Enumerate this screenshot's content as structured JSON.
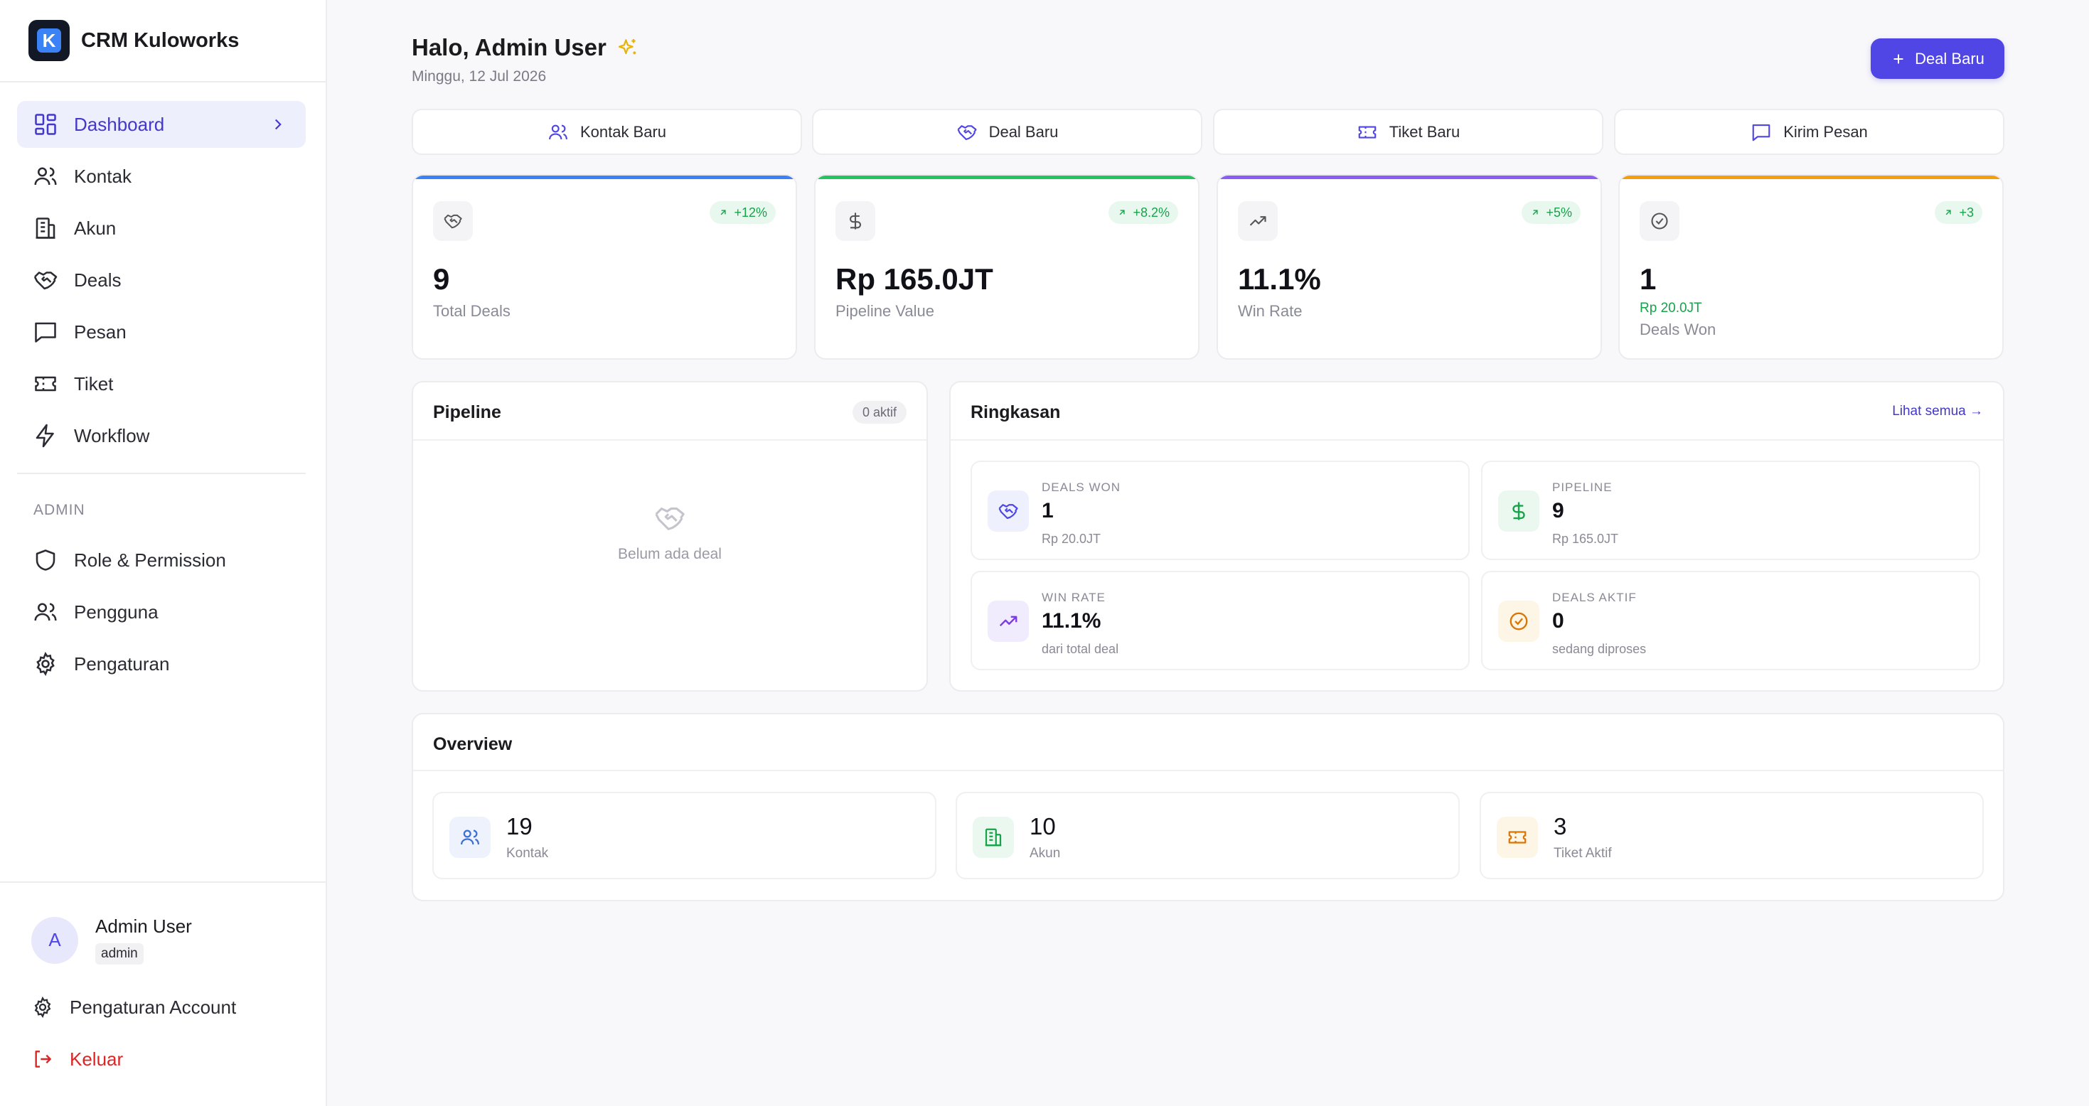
{
  "app": {
    "name": "CRM Kuloworks",
    "logo_letter": "K"
  },
  "sidebar": {
    "nav": [
      {
        "label": "Dashboard",
        "icon": "dashboard-icon",
        "active": true
      },
      {
        "label": "Kontak",
        "icon": "users-icon"
      },
      {
        "label": "Akun",
        "icon": "building-icon"
      },
      {
        "label": "Deals",
        "icon": "handshake-icon"
      },
      {
        "label": "Pesan",
        "icon": "message-icon"
      },
      {
        "label": "Tiket",
        "icon": "ticket-icon"
      },
      {
        "label": "Workflow",
        "icon": "zap-icon"
      }
    ],
    "admin_label": "ADMIN",
    "admin_nav": [
      {
        "label": "Role & Permission",
        "icon": "shield-icon"
      },
      {
        "label": "Pengguna",
        "icon": "users-icon"
      },
      {
        "label": "Pengaturan",
        "icon": "gear-icon"
      }
    ],
    "user": {
      "initial": "A",
      "name": "Admin User",
      "role": "admin"
    },
    "account_settings": "Pengaturan Account",
    "logout": "Keluar"
  },
  "header": {
    "greeting": "Halo, Admin User",
    "date": "Minggu, 12 Jul 2026",
    "primary_button": "Deal Baru"
  },
  "quick_actions": [
    {
      "label": "Kontak Baru",
      "icon": "users-icon"
    },
    {
      "label": "Deal Baru",
      "icon": "handshake-icon"
    },
    {
      "label": "Tiket Baru",
      "icon": "ticket-icon"
    },
    {
      "label": "Kirim Pesan",
      "icon": "message-icon"
    }
  ],
  "stats": [
    {
      "value": "9",
      "label": "Total Deals",
      "change": "+12%",
      "accent": "#3b82f6",
      "icon": "handshake-icon"
    },
    {
      "value": "Rp 165.0JT",
      "label": "Pipeline Value",
      "change": "+8.2%",
      "accent": "#22c55e",
      "icon": "dollar-icon"
    },
    {
      "value": "11.1%",
      "label": "Win Rate",
      "change": "+5%",
      "accent": "#8b5cf6",
      "icon": "trending-up-icon"
    },
    {
      "value": "1",
      "sub": "Rp 20.0JT",
      "label": "Deals Won",
      "change": "+3",
      "accent": "#f59e0b",
      "icon": "check-circle-icon"
    }
  ],
  "pipeline": {
    "title": "Pipeline",
    "badge": "0 aktif",
    "empty": "Belum ada deal"
  },
  "summary": {
    "title": "Ringkasan",
    "link": "Lihat semua →",
    "cards": [
      {
        "label": "DEALS WON",
        "value": "1",
        "sub": "Rp 20.0JT",
        "icon": "handshake-icon",
        "color": "#4f46e5",
        "bg": "#eef0fd"
      },
      {
        "label": "PIPELINE",
        "value": "9",
        "sub": "Rp 165.0JT",
        "icon": "dollar-icon",
        "color": "#16a34a",
        "bg": "#eaf8ef"
      },
      {
        "label": "WIN RATE",
        "value": "11.1%",
        "sub": "dari total deal",
        "icon": "trending-up-icon",
        "color": "#7c3aed",
        "bg": "#f1ecfd"
      },
      {
        "label": "DEALS AKTIF",
        "value": "0",
        "sub": "sedang diproses",
        "icon": "check-circle-icon",
        "color": "#d97706",
        "bg": "#fdf5e6"
      }
    ]
  },
  "overview": {
    "title": "Overview",
    "cards": [
      {
        "value": "19",
        "label": "Kontak",
        "icon": "users-icon",
        "color": "#3b6fd6",
        "bg": "#eef2fc"
      },
      {
        "value": "10",
        "label": "Akun",
        "icon": "building-icon",
        "color": "#16a34a",
        "bg": "#eaf8ef"
      },
      {
        "value": "3",
        "label": "Tiket Aktif",
        "icon": "ticket-icon",
        "color": "#d97706",
        "bg": "#fdf5e6"
      }
    ]
  }
}
